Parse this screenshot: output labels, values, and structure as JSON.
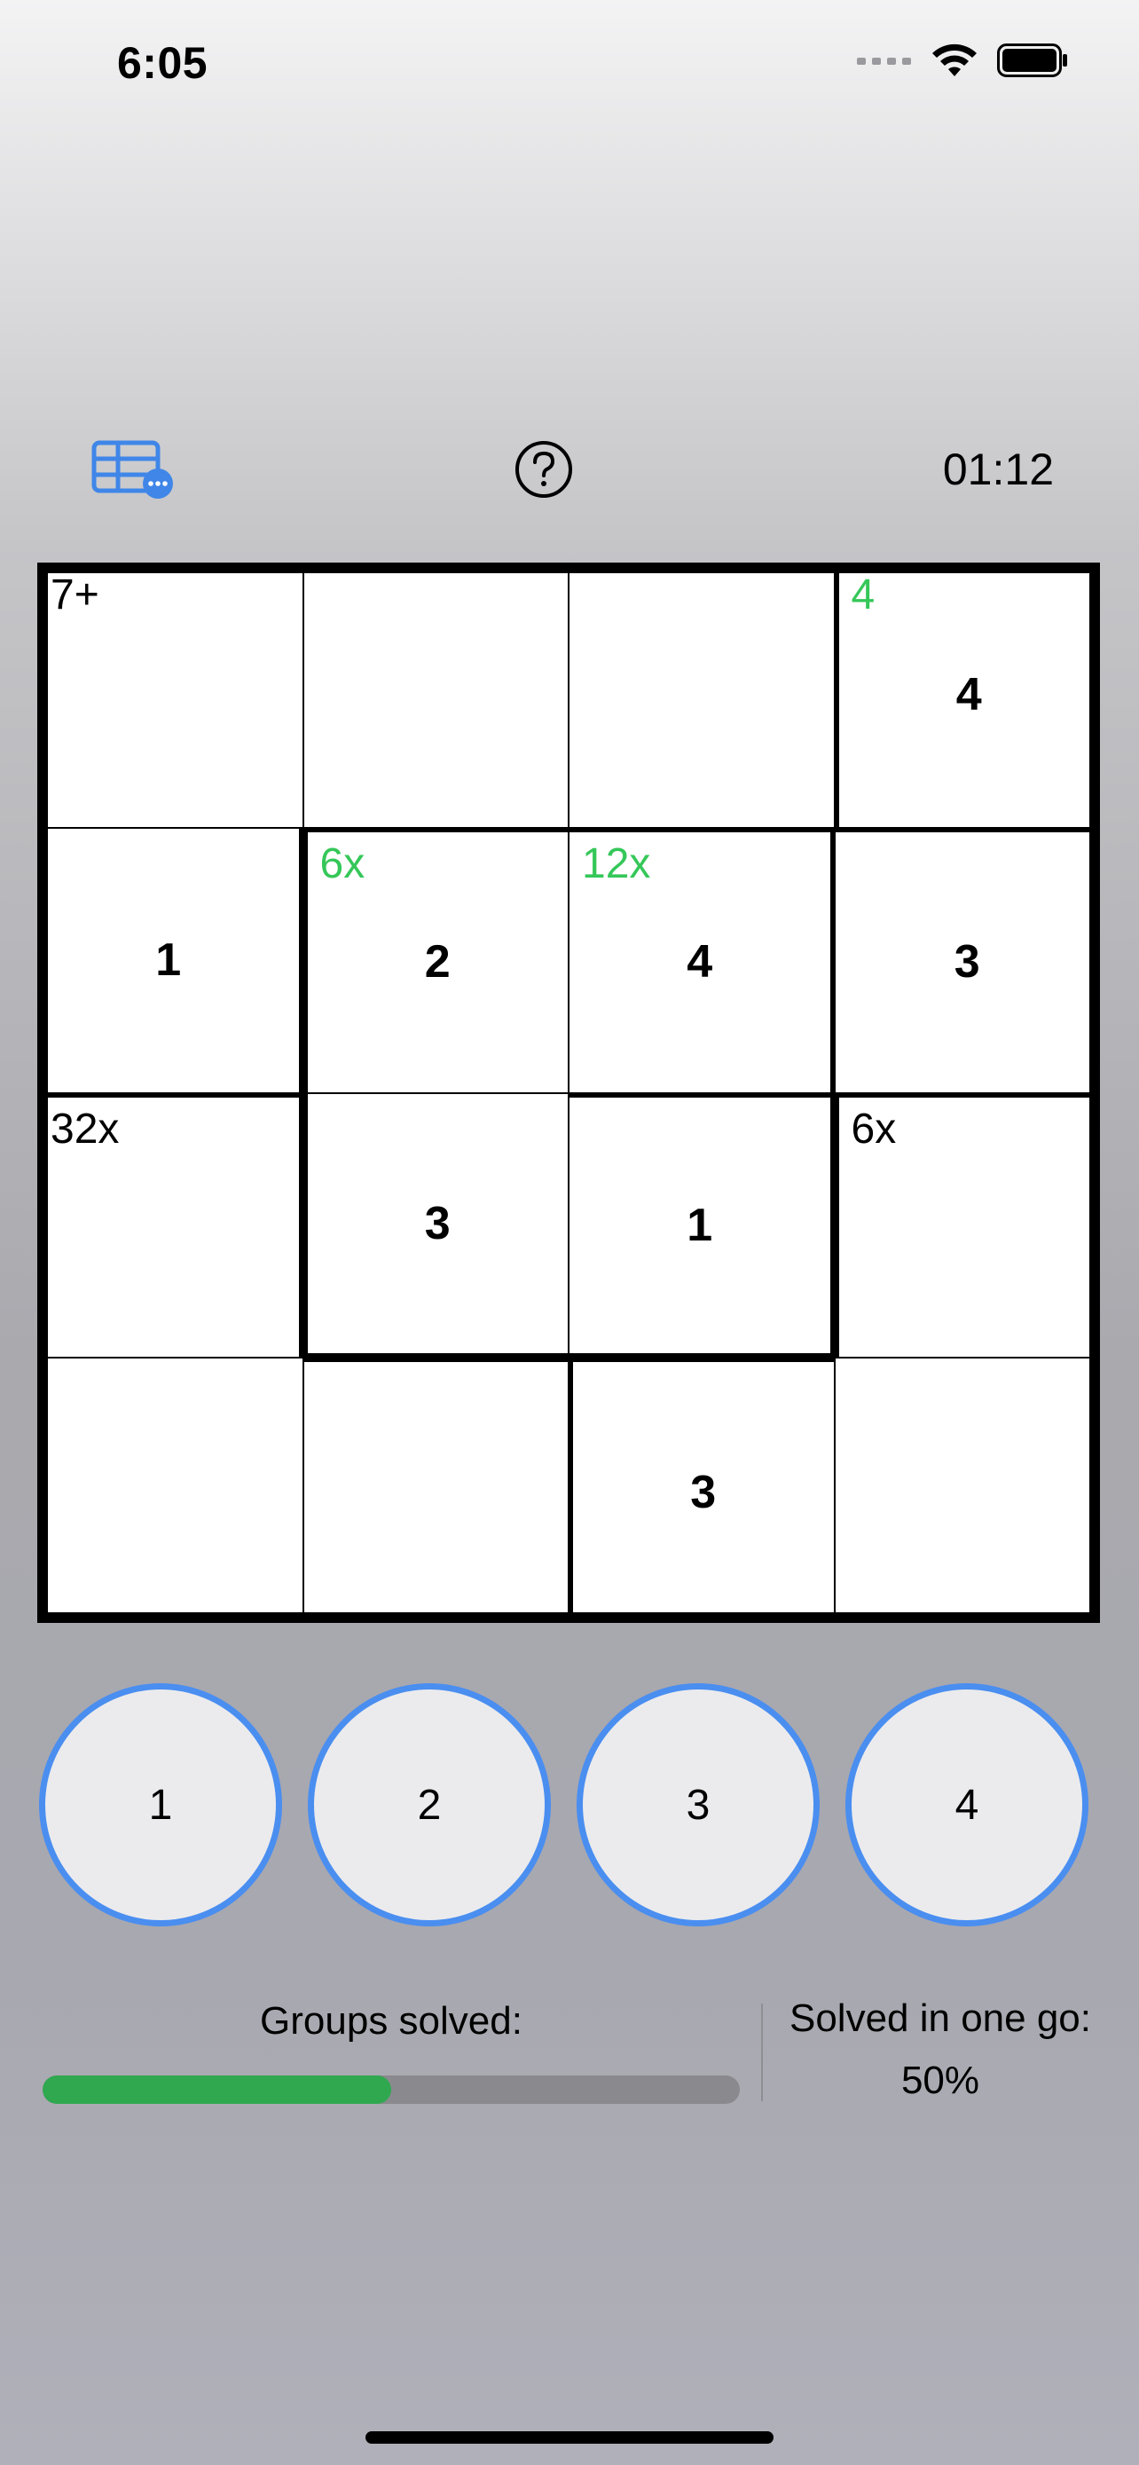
{
  "status_bar": {
    "time": "6:05",
    "icons": [
      "cellular-signal-icon",
      "wifi-icon",
      "battery-icon"
    ]
  },
  "toolbar": {
    "left_icon": "grid-menu-icon",
    "center_icon": "help-icon",
    "timer": "01:12"
  },
  "board": {
    "size": 4,
    "cells": [
      {
        "row": 0,
        "col": 0,
        "label": "7+",
        "label_solved": false,
        "value": ""
      },
      {
        "row": 0,
        "col": 1,
        "label": "",
        "label_solved": false,
        "value": ""
      },
      {
        "row": 0,
        "col": 2,
        "label": "",
        "label_solved": false,
        "value": ""
      },
      {
        "row": 0,
        "col": 3,
        "label": "4",
        "label_solved": true,
        "value": "4"
      },
      {
        "row": 1,
        "col": 0,
        "label": "",
        "label_solved": false,
        "value": "1"
      },
      {
        "row": 1,
        "col": 1,
        "label": "6x",
        "label_solved": true,
        "value": "2"
      },
      {
        "row": 1,
        "col": 2,
        "label": "12x",
        "label_solved": true,
        "value": "4"
      },
      {
        "row": 1,
        "col": 3,
        "label": "",
        "label_solved": false,
        "value": "3"
      },
      {
        "row": 2,
        "col": 0,
        "label": "32x",
        "label_solved": false,
        "value": ""
      },
      {
        "row": 2,
        "col": 1,
        "label": "",
        "label_solved": false,
        "value": "3"
      },
      {
        "row": 2,
        "col": 2,
        "label": "",
        "label_solved": false,
        "value": "1"
      },
      {
        "row": 2,
        "col": 3,
        "label": "6x",
        "label_solved": false,
        "value": ""
      },
      {
        "row": 3,
        "col": 0,
        "label": "",
        "label_solved": false,
        "value": ""
      },
      {
        "row": 3,
        "col": 1,
        "label": "",
        "label_solved": false,
        "value": ""
      },
      {
        "row": 3,
        "col": 2,
        "label": "",
        "label_solved": false,
        "value": "3"
      },
      {
        "row": 3,
        "col": 3,
        "label": "",
        "label_solved": false,
        "value": ""
      }
    ]
  },
  "numpad": [
    "1",
    "2",
    "3",
    "4"
  ],
  "stats": {
    "groups_label": "Groups solved:",
    "groups_progress": 0.5,
    "solved_label": "Solved in one go:",
    "solved_value": "50%"
  },
  "colors": {
    "accent": "#4a8ef0",
    "solved_label": "#35c759",
    "progress_fill": "#2fa84f",
    "progress_track": "#8a8a8e"
  }
}
